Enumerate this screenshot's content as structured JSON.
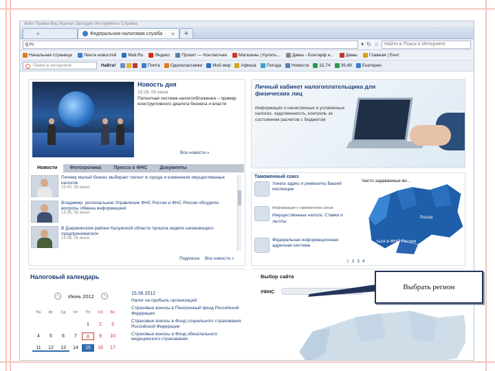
{
  "browser": {
    "menubar_text": "Файл  Правка  Вид  Журнал  Закладки  Инструменты  Справка",
    "tabs": [
      {
        "label": ""
      },
      {
        "label": "Федеральная налоговая служба"
      }
    ],
    "new_tab_glyph": "+",
    "close_glyph": "×",
    "url": "g.ru",
    "search_placeholder": "Найти в Поиск в Интернете"
  },
  "bookmarks": [
    {
      "label": "Начальная страница",
      "color": "#e07a1f"
    },
    {
      "label": "Лента новостей",
      "color": "#3a7fc9"
    },
    {
      "label": "Mail.Ru",
      "color": "#2b6fc2"
    },
    {
      "label": "Яндекс",
      "color": "#d12a20"
    },
    {
      "label": "Проект — Контактная",
      "color": "#5a7fa8"
    },
    {
      "label": "Магазины | Купить...",
      "color": "#c73a2b"
    },
    {
      "label": "Дамы - Бонтарф н...",
      "color": "#888888"
    },
    {
      "label": "Дамы",
      "color": "#c0392b"
    },
    {
      "label": "Главная | Енот",
      "color": "#d4a21a"
    }
  ],
  "toolbar2": {
    "search_placeholder": "Поиск в интернете",
    "find_label": "Найти!",
    "items": [
      {
        "label": "Почта",
        "color": "#3a7fc9"
      },
      {
        "label": "Одноклассники",
        "color": "#e07a1f"
      },
      {
        "label": "Мой мир",
        "color": "#2b6fc2"
      },
      {
        "label": "Афиша",
        "color": "#d4a21a"
      },
      {
        "label": "Погода",
        "color": "#3aa0d4"
      },
      {
        "label": "Новости",
        "color": "#5a7fa8"
      },
      {
        "label": "32,74",
        "color": "#2a9d4a"
      },
      {
        "label": "39,48",
        "color": "#2a9d4a"
      },
      {
        "label": "Екатерин",
        "color": "#3a7fc9"
      }
    ]
  },
  "news": {
    "title": "Новость дня",
    "date": "15:28, 08 июня",
    "text": "Патентная система налогообложения – пример конструктивного диалога бизнеса и власти",
    "all_news": "Все новости »",
    "tabs": [
      "Новости",
      "Фотохроника",
      "Пресса о ФНС",
      "Документы"
    ],
    "items": [
      {
        "text": "Почему малый бизнес выбирает патент в городе и изменения имущественных налогов",
        "date": "15:40, 08 июня"
      },
      {
        "text": "Владимир: региональное Управление ФНС России и ФНС России обсудили вопросы обмена информацией",
        "date": "13:36, 08 июня"
      },
      {
        "text": "В Дзержинском районе Калужской области прошла неделя начинающего предпринимателя",
        "date": "13:38, 08 июня"
      }
    ],
    "footer_links": [
      "Подписка",
      "Все новости »"
    ]
  },
  "cabinet": {
    "title": "Личный кабинет налогоплательщика для физических лиц",
    "text": "Информация о начисленных и уплаченных налогах, задолженность, контроль за состоянием расчетов с бюджетом"
  },
  "services": {
    "customs": "Таможенный союз",
    "items": [
      {
        "title": "",
        "text": "Узнать адрес и реквизиты Вашей инспекции"
      },
      {
        "title": "Информация о таможенном союзе",
        "text": "Имущественные налоги. Ставки и льготы"
      },
      {
        "title": "",
        "text": "Федеральная информационная адресная система"
      }
    ],
    "map_text_top": "Часто задаваемые во...",
    "map_text_bottom": "...ться в ФНС России",
    "map_label": "Russia",
    "pages": [
      "1",
      "2",
      "3",
      "4"
    ],
    "active_page": "1"
  },
  "calendar": {
    "title": "Налоговый календарь",
    "month": "Июнь 2012",
    "prev_glyph": "‹",
    "next_glyph": "›",
    "days_of_week": [
      "Пн",
      "Вт",
      "Ср",
      "Чт",
      "Пт",
      "Сб",
      "Вс"
    ],
    "rows": [
      [
        "",
        "",
        "",
        "",
        "1",
        "2",
        "3"
      ],
      [
        "4",
        "5",
        "6",
        "7",
        "8",
        "9",
        "10"
      ],
      [
        "11",
        "12",
        "13",
        "14",
        "15",
        "16",
        "17"
      ]
    ],
    "selected_date": "15.06.2012",
    "events": [
      "Налог на прибыль организаций",
      "Страховые взносы в Пенсионный фонд Российской Федерации",
      "Страховые взносы в Фонд социального страхования Российской Федерации",
      "Страховые взносы в Фонд обязательного медицинского страхования"
    ]
  },
  "site_choice": {
    "title": "Выбор сайта",
    "label": "УФНС"
  },
  "callout": {
    "text": "Выбрать регион"
  }
}
